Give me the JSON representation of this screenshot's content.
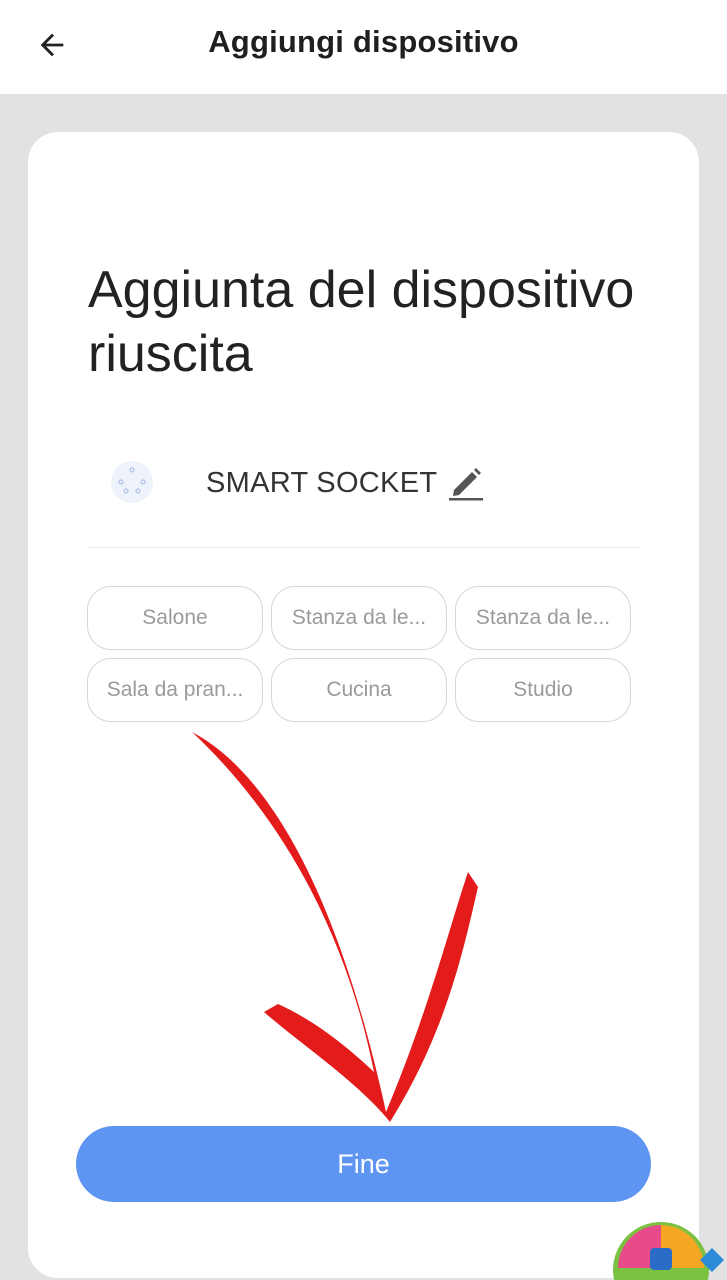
{
  "header": {
    "title": "Aggiungi dispositivo",
    "back_icon": "arrow-left-icon"
  },
  "content": {
    "headline": "Aggiunta del dispositivo riuscita",
    "device": {
      "name": "SMART SOCKET",
      "icon": "device-icon",
      "edit_icon": "pencil-icon"
    },
    "rooms": [
      "Salone",
      "Stanza da le...",
      "Stanza da le...",
      "Sala da pran...",
      "Cucina",
      "Studio"
    ],
    "done_label": "Fine"
  },
  "colors": {
    "primary_button": "#5f95f2",
    "background": "#e2e2e2",
    "annotation_arrow": "#e41b1b"
  }
}
